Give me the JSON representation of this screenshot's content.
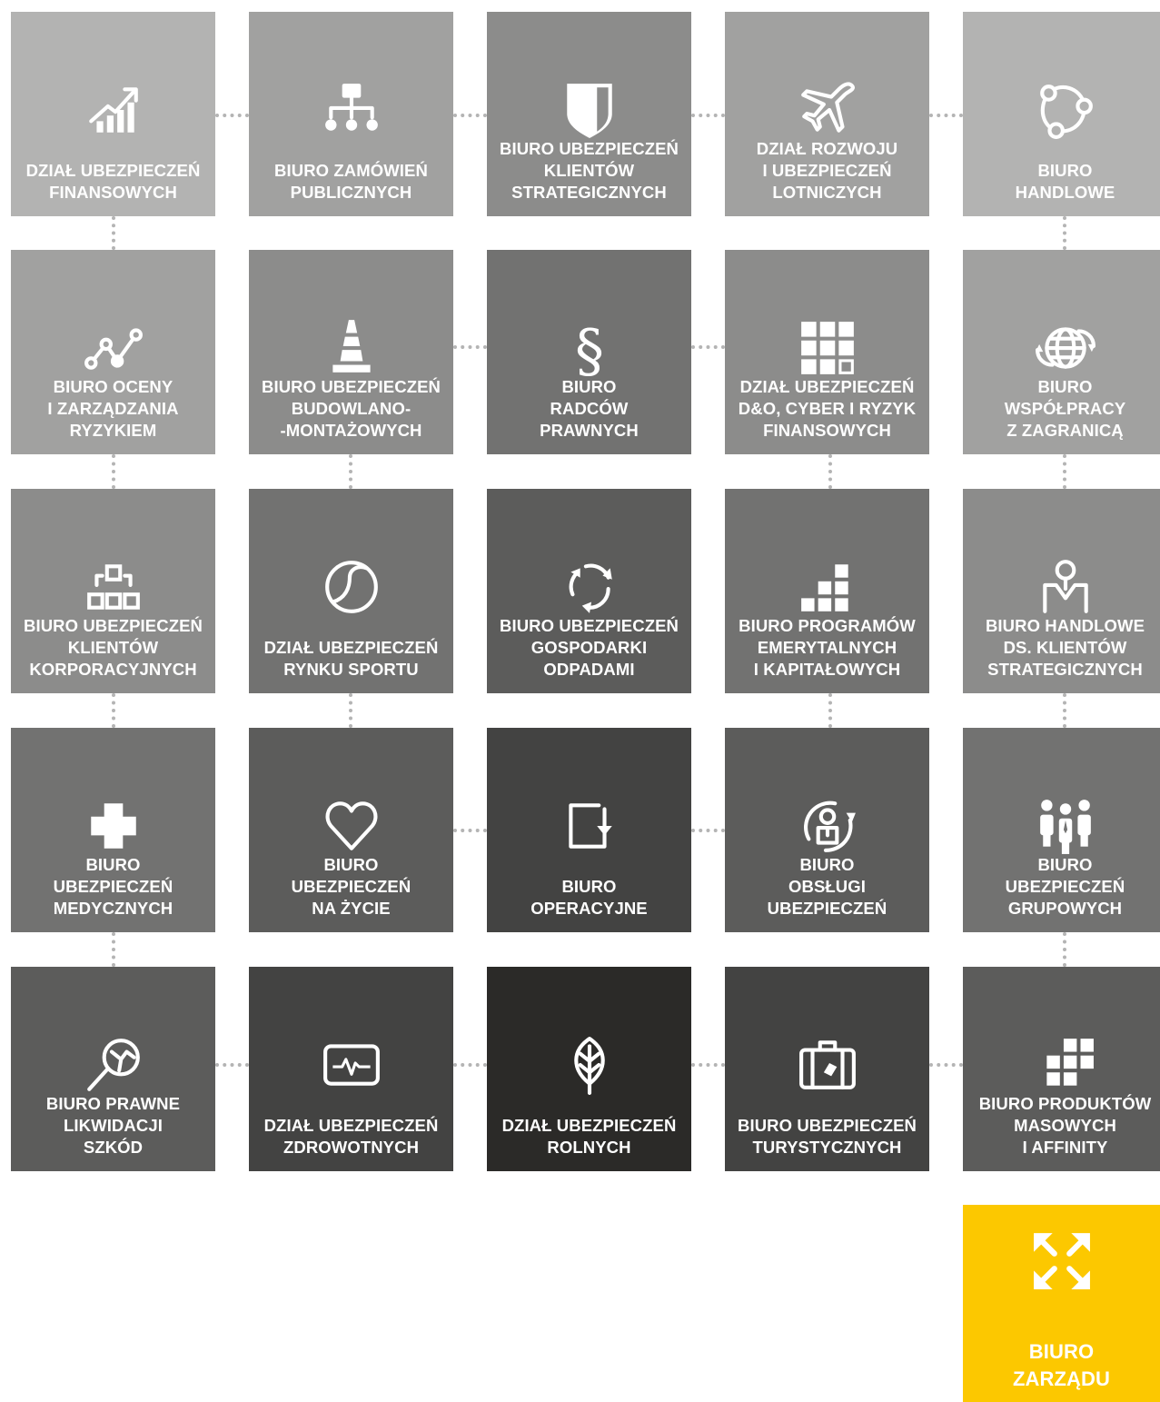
{
  "tiles": [
    {
      "id": "dzial-ubezpieczen-finansowych",
      "label": "DZIAŁ UBEZPIECZEŃ\nFINANSOWYCH",
      "icon": "growth-chart-icon",
      "color": "#b3b3b2"
    },
    {
      "id": "biuro-zamowien-publicznych",
      "label": "BIURO ZAMÓWIEŃ\nPUBLICZNYCH",
      "icon": "hierarchy-icon",
      "color": "#a1a1a0"
    },
    {
      "id": "biuro-ubezpieczen-klientow-strategicznych",
      "label": "BIURO UBEZPIECZEŃ\nKLIENTÓW\nSTRATEGICZNYCH",
      "icon": "shield-icon",
      "color": "#8c8c8b"
    },
    {
      "id": "dzial-rozwoju-i-ubezpieczen-lotniczych",
      "label": "DZIAŁ ROZWOJU\nI UBEZPIECZEŃ\nLOTNICZYCH",
      "icon": "airplane-icon",
      "color": "#a1a1a0"
    },
    {
      "id": "biuro-handlowe",
      "label": "BIURO\nHANDLOWE",
      "icon": "network-nodes-icon",
      "color": "#b3b3b2"
    },
    {
      "id": "biuro-oceny-i-zarzadzania-ryzykiem",
      "label": "BIURO OCENY\nI ZARZĄDZANIA\nRYZYKIEM",
      "icon": "line-graph-icon",
      "color": "#a1a1a0"
    },
    {
      "id": "biuro-ubezpieczen-budowlano-montazowych",
      "label": "BIURO UBEZPIECZEŃ\nBUDOWLANO-\n-MONTAŻOWYCH",
      "icon": "traffic-cone-icon",
      "color": "#8c8c8b"
    },
    {
      "id": "biuro-radcow-prawnych",
      "label": "BIURO\nRADCÓW\nPRAWNYCH",
      "icon": "paragraph-icon",
      "color": "#727271"
    },
    {
      "id": "dzial-ubezpieczen-do-cyber",
      "label": "DZIAŁ UBEZPIECZEŃ\nD&O, CYBER I RYZYK\nFINANSOWYCH",
      "icon": "grid-squares-icon",
      "color": "#8c8c8b"
    },
    {
      "id": "biuro-wspolpracy-z-zagranica",
      "label": "BIURO\nWSPÓŁPRACY\nZ ZAGRANICĄ",
      "icon": "globe-arrows-icon",
      "color": "#a1a1a0"
    },
    {
      "id": "biuro-ubezpieczen-klientow-korporacyjnych",
      "label": "BIURO UBEZPIECZEŃ\nKLIENTÓW\nKORPORACYJNYCH",
      "icon": "building-blocks-icon",
      "color": "#8c8c8b"
    },
    {
      "id": "dzial-ubezpieczen-rynku-sportu",
      "label": "DZIAŁ UBEZPIECZEŃ\nRYNKU SPORTU",
      "icon": "tennis-ball-icon",
      "color": "#727271"
    },
    {
      "id": "biuro-ubezpieczen-gospodarki-odpadami",
      "label": "BIURO UBEZPIECZEŃ\nGOSPODARKI\nODPADAMI",
      "icon": "recycle-icon",
      "color": "#5c5c5b"
    },
    {
      "id": "biuro-programow-emerytalnych",
      "label": "BIURO PROGRAMÓW\nEMERYTALNYCH\nI KAPITAŁOWYCH",
      "icon": "stacked-blocks-icon",
      "color": "#727271"
    },
    {
      "id": "biuro-handlowe-ds-klientow-strategicznych",
      "label": "BIURO HANDLOWE\nDS. KLIENTÓW\nSTRATEGICZNYCH",
      "icon": "location-person-icon",
      "color": "#8c8c8b"
    },
    {
      "id": "biuro-ubezpieczen-medycznych",
      "label": "BIURO\nUBEZPIECZEŃ\nMEDYCZNYCH",
      "icon": "medical-cross-icon",
      "color": "#727271"
    },
    {
      "id": "biuro-ubezpieczen-na-zycie",
      "label": "BIURO\nUBEZPIECZEŃ\nNA ŻYCIE",
      "icon": "heart-icon",
      "color": "#5c5c5b"
    },
    {
      "id": "biuro-operacyjne",
      "label": "BIURO\nOPERACYJNE",
      "icon": "corner-arrow-box-icon",
      "color": "#434342"
    },
    {
      "id": "biuro-obslugi-ubezpieczen",
      "label": "BIURO\nOBSŁUGI\nUBEZPIECZEŃ",
      "icon": "person-cycle-icon",
      "color": "#5c5c5b"
    },
    {
      "id": "biuro-ubezpieczen-grupowych",
      "label": "BIURO\nUBEZPIECZEŃ\nGRUPOWYCH",
      "icon": "group-people-icon",
      "color": "#727271"
    },
    {
      "id": "biuro-prawne-likwidacji-szkod",
      "label": "BIURO PRAWNE\nLIKWIDACJI\nSZKÓD",
      "icon": "magnifier-broken-icon",
      "color": "#5c5c5b"
    },
    {
      "id": "dzial-ubezpieczen-zdrowotnych",
      "label": "DZIAŁ UBEZPIECZEŃ\nZDROWOTNYCH",
      "icon": "heartbeat-monitor-icon",
      "color": "#434342"
    },
    {
      "id": "dzial-ubezpieczen-rolnych",
      "label": "DZIAŁ UBEZPIECZEŃ\nROLNYCH",
      "icon": "leaf-icon",
      "color": "#2b2a28"
    },
    {
      "id": "biuro-ubezpieczen-turystycznych",
      "label": "BIURO UBEZPIECZEŃ\nTURYSTYCZNYCH",
      "icon": "suitcase-icon",
      "color": "#434342"
    },
    {
      "id": "biuro-produktow-masowych-i-affinity",
      "label": "BIURO PRODUKTÓW\nMASOWYCH\nI AFFINITY",
      "icon": "blocks-cluster-icon",
      "color": "#5c5c5b"
    },
    {
      "id": "biuro-zarzadu",
      "label": "BIURO\nZARZĄDU",
      "icon": "expand-arrows-icon",
      "color": "#fcc800"
    }
  ]
}
